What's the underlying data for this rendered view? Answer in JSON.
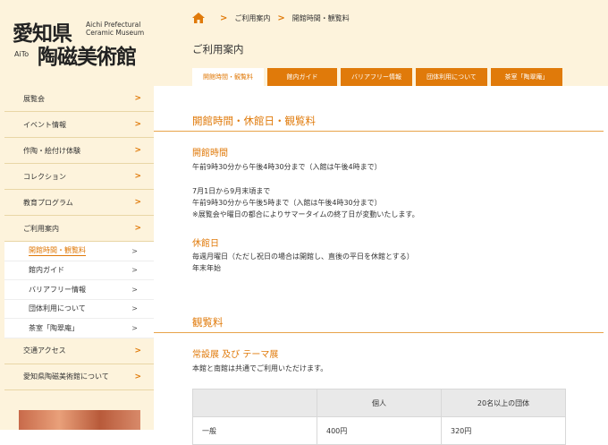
{
  "logo": {
    "kanji_line1": "愛知県",
    "kanji_line2": "陶磁美術館",
    "aito": "AiTo",
    "en_line1": "Aichi Prefectural",
    "en_line2": "Ceramic Museum"
  },
  "breadcrumb": {
    "item1": "ご利用案内",
    "item2": "開館時間・観覧料"
  },
  "page_title": "ご利用案内",
  "tabs": [
    "開館時間・観覧料",
    "館内ガイド",
    "バリアフリー情報",
    "団体利用について",
    "茶室「陶翠庵」"
  ],
  "nav": {
    "items": [
      "展覧会",
      "イベント情報",
      "作陶・絵付け体験",
      "コレクション",
      "教育プログラム",
      "ご利用案内"
    ],
    "sub_items": [
      "開館時間・観覧料",
      "館内ガイド",
      "バリアフリー情報",
      "団体利用について",
      "茶室「陶翠庵」"
    ],
    "items_after": [
      "交通アクセス",
      "愛知県陶磁美術館について"
    ],
    "arrow": ">"
  },
  "content": {
    "section1_title": "開館時間・休館日・観覧料",
    "hours_title": "開館時間",
    "hours_text1": "午前9時30分から午後4時30分まで（入館は午後4時まで）",
    "hours_text2": "7月1日から9月末頃まで",
    "hours_text3": "午前9時30分から午後5時まで（入館は午後4時30分まで）",
    "hours_text4": "※展覧会や曜日の都合によりサマータイムの終了日が変動いたします。",
    "closed_title": "休館日",
    "closed_text1": "毎週月曜日（ただし祝日の場合は開館し、直後の平日を休館とする）",
    "closed_text2": "年末年始",
    "section2_title": "観覧料",
    "permanent_title": "常設展 及び テーマ展",
    "permanent_text": "本館と南館は共通でご利用いただけます。",
    "table": {
      "header": [
        "",
        "個人",
        "20名以上の団体"
      ],
      "row1": [
        "一般",
        "400円",
        "320円"
      ]
    }
  },
  "colors": {
    "accent": "#e07a0a",
    "panel": "#fdf3dc"
  }
}
